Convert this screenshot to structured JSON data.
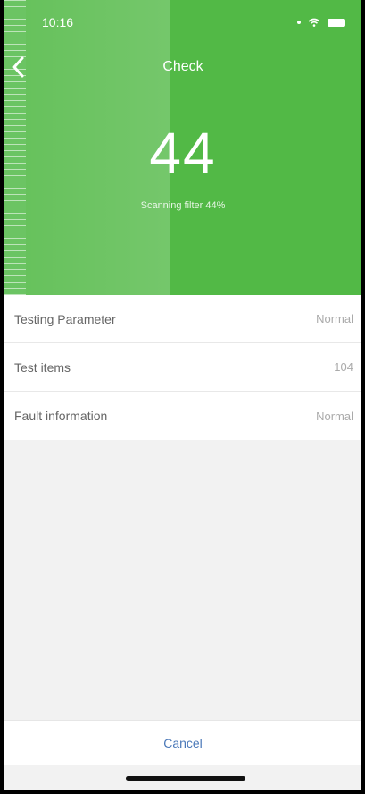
{
  "status_bar": {
    "time": "10:16"
  },
  "header": {
    "title": "Check"
  },
  "progress": {
    "value": "44",
    "label": "Scanning filter 44%",
    "percent": 44
  },
  "results": [
    {
      "label": "Testing Parameter",
      "value": "Normal"
    },
    {
      "label": "Test items",
      "value": "104"
    },
    {
      "label": "Fault information",
      "value": "Normal"
    }
  ],
  "footer": {
    "cancel_label": "Cancel"
  },
  "colors": {
    "hero_green": "#52b946",
    "cancel_blue": "#4a78b8"
  }
}
